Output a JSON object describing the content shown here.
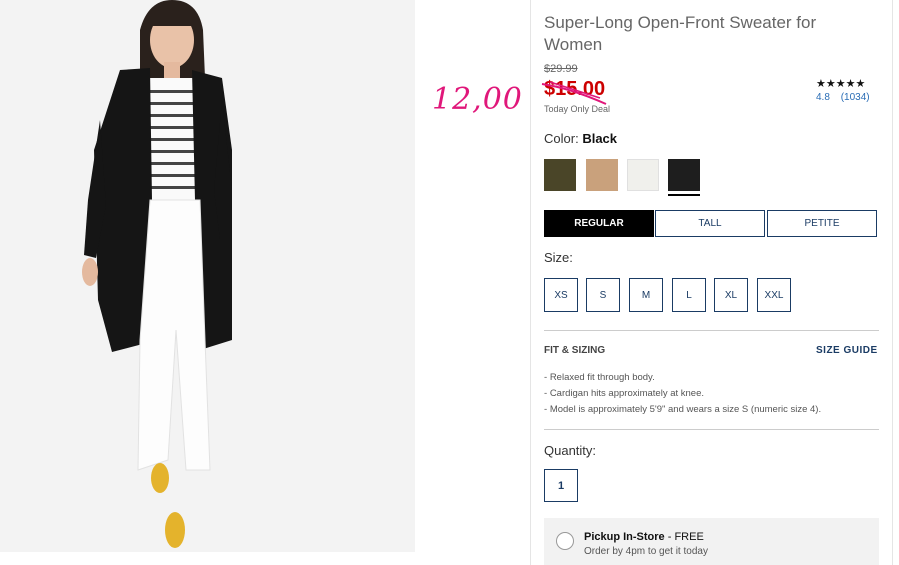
{
  "product": {
    "title": "Super-Long Open-Front Sweater for Women",
    "old_price": "$29.99",
    "price": "$15.00",
    "deal_label": "Today Only Deal",
    "handwritten_price": "12,00",
    "stars": "★★★★★",
    "rating": "4.8",
    "review_count": "(1034)"
  },
  "color": {
    "label": "Color:",
    "selected": "Black",
    "swatches": [
      {
        "name": "olive",
        "hex": "#4a4528"
      },
      {
        "name": "camel",
        "hex": "#c9a17c"
      },
      {
        "name": "ivory",
        "hex": "#f0f0ec"
      },
      {
        "name": "black",
        "hex": "#1e1e1e"
      }
    ]
  },
  "fits": [
    "REGULAR",
    "TALL",
    "PETITE"
  ],
  "size": {
    "label": "Size:",
    "options": [
      "XS",
      "S",
      "M",
      "L",
      "XL",
      "XXL"
    ]
  },
  "fit_sizing": {
    "title": "FIT & SIZING",
    "guide_link": "SIZE GUIDE",
    "bullets": [
      "Relaxed fit through body.",
      "Cardigan hits approximately at knee.",
      "Model is approximately 5'9\" and wears a size S (numeric size 4)."
    ]
  },
  "quantity": {
    "label": "Quantity:",
    "value": "1"
  },
  "pickup": {
    "title": "Pickup In-Store",
    "suffix": " - FREE",
    "subtitle": "Order by 4pm to get it today"
  },
  "colors": {
    "sale_red": "#cc0000",
    "navy": "#1a3b64",
    "handwriting_pink": "#e0177a"
  }
}
